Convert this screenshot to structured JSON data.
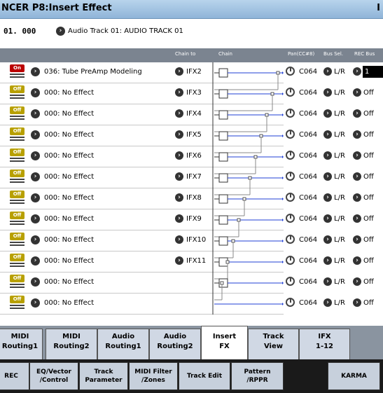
{
  "title": {
    "left": "NCER P8:Insert Effect",
    "right": "I"
  },
  "song": {
    "number": "01. 000",
    "track_name": "Audio Track 01: AUDIO TRACK 01"
  },
  "columns": [
    "Chain to",
    "Chain",
    "Pan(CC#8)",
    "Bus Sel.",
    "REC Bus"
  ],
  "rows": [
    {
      "onoff": "On",
      "fx": "036: Tube PreAmp Modeling",
      "chain_to": "IFX2",
      "pan": "C064",
      "bus": "L/R",
      "rec": "1"
    },
    {
      "onoff": "Off",
      "fx": "000: No Effect",
      "chain_to": "IFX3",
      "pan": "C064",
      "bus": "L/R",
      "rec": "Off"
    },
    {
      "onoff": "Off",
      "fx": "000: No Effect",
      "chain_to": "IFX4",
      "pan": "C064",
      "bus": "L/R",
      "rec": "Off"
    },
    {
      "onoff": "Off",
      "fx": "000: No Effect",
      "chain_to": "IFX5",
      "pan": "C064",
      "bus": "L/R",
      "rec": "Off"
    },
    {
      "onoff": "Off",
      "fx": "000: No Effect",
      "chain_to": "IFX6",
      "pan": "C064",
      "bus": "L/R",
      "rec": "Off"
    },
    {
      "onoff": "Off",
      "fx": "000: No Effect",
      "chain_to": "IFX7",
      "pan": "C064",
      "bus": "L/R",
      "rec": "Off"
    },
    {
      "onoff": "Off",
      "fx": "000: No Effect",
      "chain_to": "IFX8",
      "pan": "C064",
      "bus": "L/R",
      "rec": "Off"
    },
    {
      "onoff": "Off",
      "fx": "000: No Effect",
      "chain_to": "IFX9",
      "pan": "C064",
      "bus": "L/R",
      "rec": "Off"
    },
    {
      "onoff": "Off",
      "fx": "000: No Effect",
      "chain_to": "IFX10",
      "pan": "C064",
      "bus": "L/R",
      "rec": "Off"
    },
    {
      "onoff": "Off",
      "fx": "000: No Effect",
      "chain_to": "IFX11",
      "pan": "C064",
      "bus": "L/R",
      "rec": "Off"
    },
    {
      "onoff": "Off",
      "fx": "000: No Effect",
      "chain_to": "",
      "pan": "C064",
      "bus": "L/R",
      "rec": "Off"
    },
    {
      "onoff": "Off",
      "fx": "000: No Effect",
      "chain_to": "",
      "pan": "C064",
      "bus": "L/R",
      "rec": "Off"
    }
  ],
  "tabs_top": [
    {
      "l1": "MIDI",
      "l2": "Routing1"
    },
    {
      "l1": "MIDI",
      "l2": "Routing2"
    },
    {
      "l1": "Audio",
      "l2": "Routing1"
    },
    {
      "l1": "Audio",
      "l2": "Routing2"
    },
    {
      "l1": "Insert",
      "l2": "FX"
    },
    {
      "l1": "Track",
      "l2": "View"
    },
    {
      "l1": "IFX",
      "l2": "1-12"
    }
  ],
  "tabs_bottom": [
    {
      "l1": "REC",
      "l2": ""
    },
    {
      "l1": "EQ/Vector",
      "l2": "/Control"
    },
    {
      "l1": "Track",
      "l2": "Parameter"
    },
    {
      "l1": "MIDI Filter",
      "l2": "/Zones"
    },
    {
      "l1": "Track Edit",
      "l2": ""
    },
    {
      "l1": "Pattern",
      "l2": "/RPPR"
    },
    {
      "l1": "KARMA",
      "l2": ""
    }
  ],
  "colors": {
    "chain_line": "#1f3fd6",
    "on": "#bb0000",
    "off": "#b8a000",
    "header_bg": "#7b8490"
  }
}
